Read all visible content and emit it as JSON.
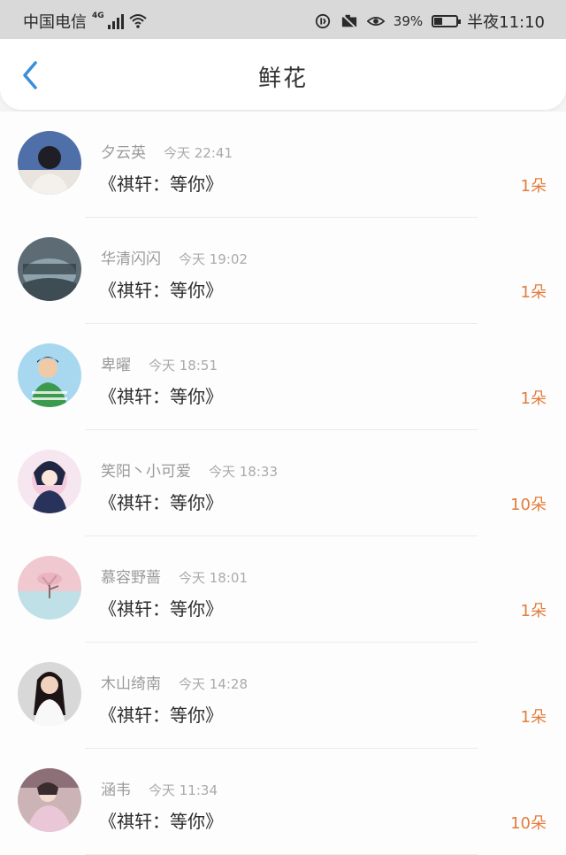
{
  "status_bar": {
    "carrier": "中国电信",
    "network": "4G",
    "battery": "39%",
    "battery_level": 0.39,
    "time": "半夜11:10"
  },
  "header": {
    "title": "鲜花",
    "back_icon": "chevron-left-icon"
  },
  "colors": {
    "accent": "#3a8fd9",
    "count": "#e37c3a"
  },
  "records": [
    {
      "name": "夕云英",
      "time": "今天 22:41",
      "message": "《祺轩：等你》",
      "count": "1朵"
    },
    {
      "name": "华清闪闪",
      "time": "今天 19:02",
      "message": "《祺轩：等你》",
      "count": "1朵"
    },
    {
      "name": "卑曜",
      "time": "今天 18:51",
      "message": "《祺轩：等你》",
      "count": "1朵"
    },
    {
      "name": "笑阳丶小可爱",
      "time": "今天 18:33",
      "message": "《祺轩：等你》",
      "count": "10朵"
    },
    {
      "name": "慕容野蔷",
      "time": "今天 18:01",
      "message": "《祺轩：等你》",
      "count": "1朵"
    },
    {
      "name": "木山绮南",
      "time": "今天 14:28",
      "message": "《祺轩：等你》",
      "count": "1朵"
    },
    {
      "name": "涵韦",
      "time": "今天 11:34",
      "message": "《祺轩：等你》",
      "count": "10朵"
    }
  ]
}
